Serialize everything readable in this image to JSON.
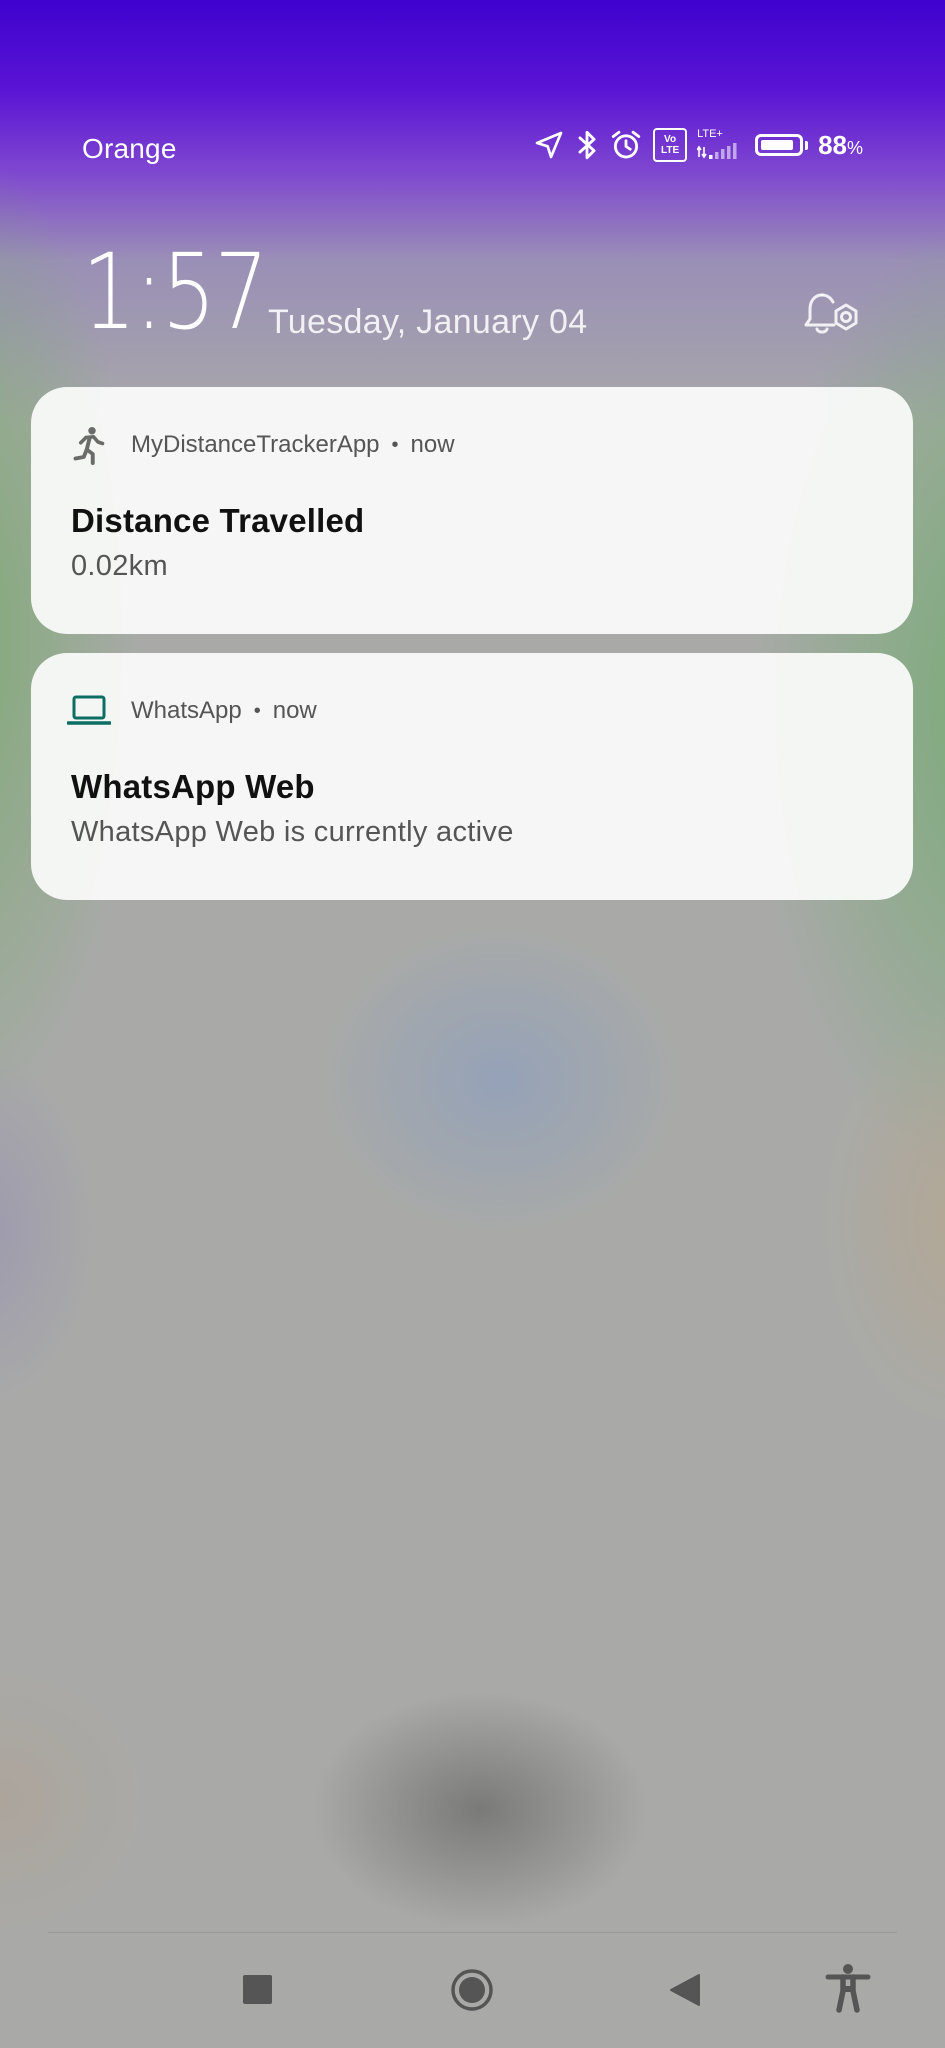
{
  "status_bar": {
    "carrier": "Orange",
    "network_type": "LTE+",
    "volte_badge": [
      "Vo",
      "LTE"
    ],
    "battery_percent": "88",
    "battery_unit": "%",
    "battery_level": 0.88,
    "icons": [
      "location-arrow-icon",
      "bluetooth-icon",
      "alarm-clock-icon",
      "volte-icon",
      "signal-icon",
      "battery-icon"
    ]
  },
  "lock_screen": {
    "time": "1:57",
    "date": "Tuesday, January 04",
    "notification_settings_icon": "bell-settings-icon"
  },
  "notifications": [
    {
      "app_icon": "running-person-icon",
      "app_name": "MyDistanceTrackerApp",
      "separator": "•",
      "time": "now",
      "title": "Distance Travelled",
      "body": "0.02km"
    },
    {
      "app_icon": "laptop-icon",
      "app_name": "WhatsApp",
      "separator": "•",
      "time": "now",
      "title": "WhatsApp Web",
      "body": "WhatsApp Web is currently active"
    }
  ],
  "nav_bar": {
    "icons": [
      "recents-square-icon",
      "home-circle-icon",
      "back-triangle-icon",
      "accessibility-icon"
    ]
  },
  "colors": {
    "top_gradient": "#3f02cf",
    "card_background": "#f8f9f8",
    "whatsapp_icon": "#0b6e62",
    "app_icon_grey": "#6b6b6b"
  }
}
